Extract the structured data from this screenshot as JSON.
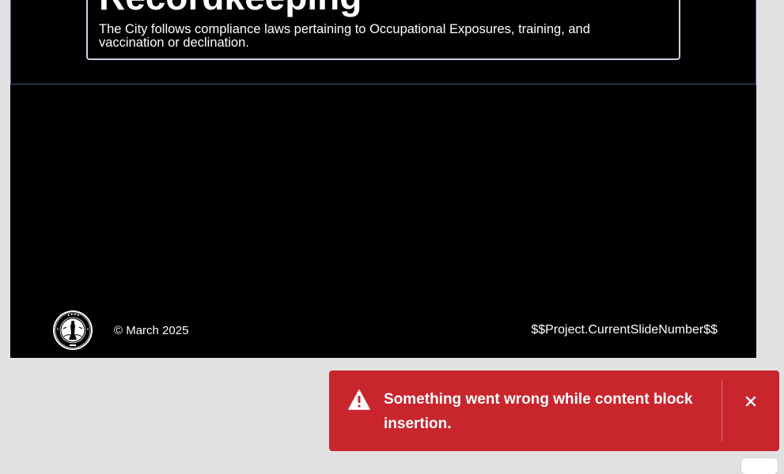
{
  "slide": {
    "heading": "Recordkeeping",
    "body": "The City follows compliance laws pertaining to Occupational Exposures, training, and vaccination or declination.",
    "footer_left": "© March 2025",
    "footer_right": "$$Project.CurrentSlideNumber$$"
  },
  "toast": {
    "message": "Something went wrong while content block insertion.",
    "icon": "alert-triangle-icon",
    "close_icon": "close-icon",
    "color": "#c9252d"
  },
  "colors": {
    "slide_background": "#000000",
    "workspace_background": "#e1e1e1",
    "selection_border": "#3f5a8a"
  }
}
